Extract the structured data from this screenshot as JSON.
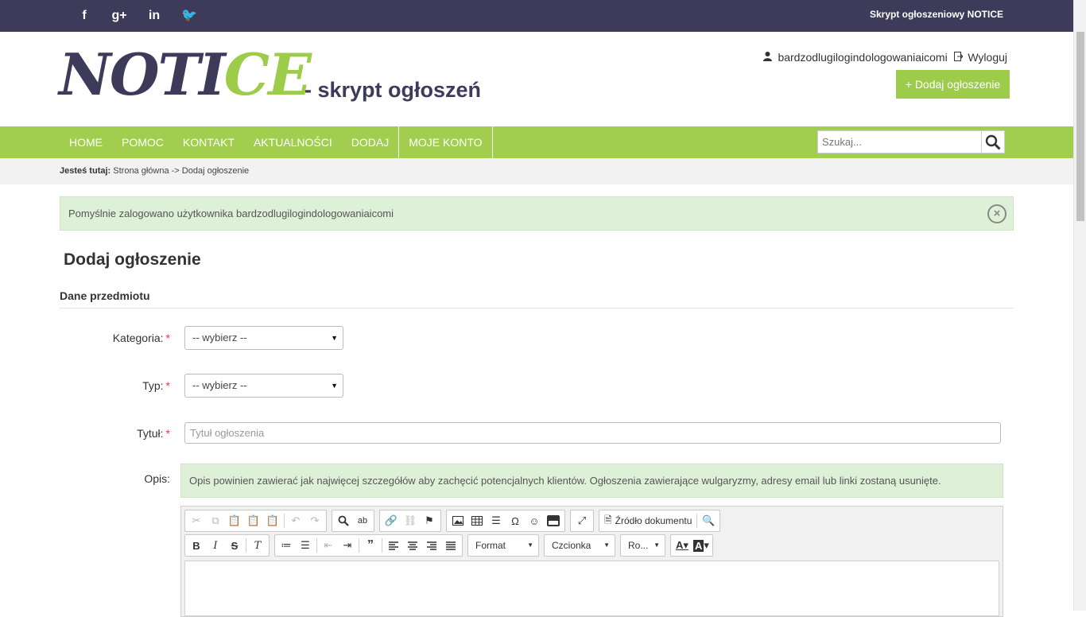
{
  "topbar": {
    "social_icons": [
      "facebook-icon",
      "google-plus-icon",
      "linkedin-icon",
      "twitter-icon"
    ],
    "social_glyphs": [
      "f",
      "g+",
      "in",
      "🐦"
    ],
    "brand_text": "Skrypt ogłoszeniowy NOTICE"
  },
  "header": {
    "logo_part1": "NOTI",
    "logo_part2": "CE",
    "tagline": "- skrypt ogłoszeń",
    "username": "bardzodlugilogindologowaniaicomi",
    "logout": "Wyloguj",
    "add_button": "+ Dodaj ogłoszenie"
  },
  "nav": {
    "items": [
      "HOME",
      "POMOC",
      "KONTAKT",
      "AKTUALNOŚCI",
      "DODAJ",
      "MOJE KONTO"
    ],
    "search_placeholder": "Szukaj..."
  },
  "breadcrumb": {
    "label": "Jesteś tutaj:",
    "path": "Strona główna -> Dodaj ogłoszenie"
  },
  "alert": {
    "message": "Pomyślnie zalogowano użytkownika bardzodlugilogindologowaniaicomi"
  },
  "page_title": "Dodaj ogłoszenie",
  "section_title": "Dane przedmiotu",
  "form": {
    "category_label": "Kategoria:",
    "category_value": "-- wybierz --",
    "type_label": "Typ:",
    "type_value": "-- wybierz --",
    "title_label": "Tytuł:",
    "title_placeholder": "Tytuł ogłoszenia",
    "description_label": "Opis:",
    "description_hint": "Opis powinien zawierać jak najwięcej szczegółów aby zachęcić potencjalnych klientów. Ogłoszenia zawierające wulgaryzmy, adresy email lub linki zostaną usunięte.",
    "required_mark": "*"
  },
  "editor": {
    "source_label": "Źródło dokumentu",
    "format_label": "Format",
    "font_label": "Czcionka",
    "size_label": "Ro..."
  },
  "colors": {
    "topbar": "#3d3a5a",
    "accent": "#a2ce4f",
    "alert_bg": "#dff0d8"
  }
}
